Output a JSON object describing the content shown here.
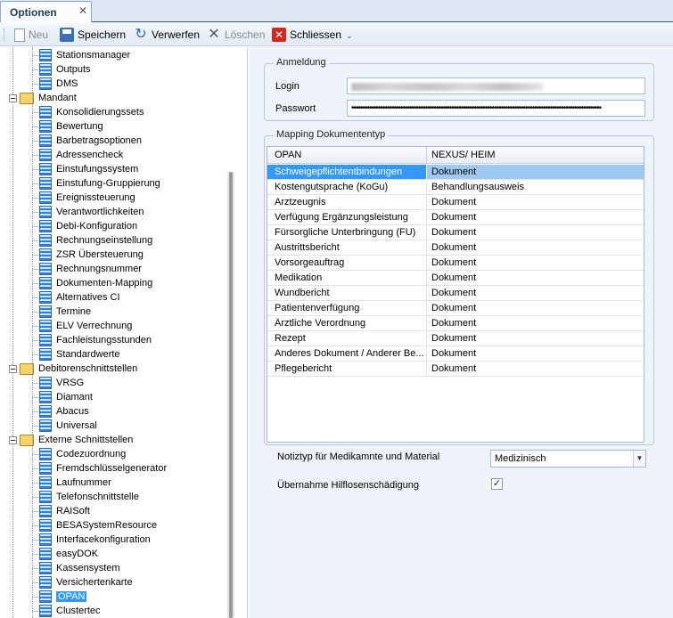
{
  "tab": {
    "label": "Optionen",
    "close": "✕"
  },
  "toolbar": {
    "new": "Neu",
    "save": "Speichern",
    "discard": "Verwerfen",
    "delete": "Löschen",
    "close": "Schliessen"
  },
  "tree": {
    "groups": [
      {
        "label": "Stationsmanager",
        "kind": "leaf"
      },
      {
        "label": "Outputs",
        "kind": "leaf"
      },
      {
        "label": "DMS",
        "kind": "leaf"
      },
      {
        "label": "Mandant",
        "kind": "folder"
      },
      {
        "label": "Konsolidierungssets",
        "kind": "leaf"
      },
      {
        "label": "Bewertung",
        "kind": "leaf"
      },
      {
        "label": "Barbetragsoptionen",
        "kind": "leaf"
      },
      {
        "label": "Adressencheck",
        "kind": "leaf"
      },
      {
        "label": "Einstufungssystem",
        "kind": "leaf"
      },
      {
        "label": "Einstufung-Gruppierung",
        "kind": "leaf"
      },
      {
        "label": "Ereignissteuerung",
        "kind": "leaf"
      },
      {
        "label": "Verantwortlichkeiten",
        "kind": "leaf"
      },
      {
        "label": "Debi-Konfiguration",
        "kind": "leaf"
      },
      {
        "label": "Rechnungseinstellung",
        "kind": "leaf"
      },
      {
        "label": "ZSR Übersteuerung",
        "kind": "leaf"
      },
      {
        "label": "Rechnungsnummer",
        "kind": "leaf"
      },
      {
        "label": "Dokumenten-Mapping",
        "kind": "leaf"
      },
      {
        "label": "Alternatives CI",
        "kind": "leaf"
      },
      {
        "label": "Termine",
        "kind": "leaf"
      },
      {
        "label": "ELV Verrechnung",
        "kind": "leaf"
      },
      {
        "label": "Fachleistungsstunden",
        "kind": "leaf"
      },
      {
        "label": "Standardwerte",
        "kind": "leaf"
      },
      {
        "label": "Debitorenschnittstellen",
        "kind": "folder"
      },
      {
        "label": "VRSG",
        "kind": "leaf"
      },
      {
        "label": "Diamant",
        "kind": "leaf"
      },
      {
        "label": "Abacus",
        "kind": "leaf"
      },
      {
        "label": "Universal",
        "kind": "leaf"
      },
      {
        "label": "Externe Schnittstellen",
        "kind": "folder"
      },
      {
        "label": "Codezuordnung",
        "kind": "leaf"
      },
      {
        "label": "Fremdschlüsselgenerator",
        "kind": "leaf"
      },
      {
        "label": "Laufnummer",
        "kind": "leaf"
      },
      {
        "label": "Telefonschnittstelle",
        "kind": "leaf"
      },
      {
        "label": "RAISoft",
        "kind": "leaf"
      },
      {
        "label": "BESASystemResource",
        "kind": "leaf"
      },
      {
        "label": "Interfacekonfiguration",
        "kind": "leaf"
      },
      {
        "label": "easyDOK",
        "kind": "leaf"
      },
      {
        "label": "Kassensystem",
        "kind": "leaf"
      },
      {
        "label": "Versichertenkarte",
        "kind": "leaf"
      },
      {
        "label": "OPAN",
        "kind": "leaf",
        "selected": true
      },
      {
        "label": "Clustertec",
        "kind": "leaf"
      }
    ]
  },
  "anmeldung": {
    "title": "Anmeldung",
    "login_label": "Login",
    "password_label": "Passwort",
    "password_mask": "••••••••••••••••••••••••••••••••••••••••••••••••••••••••••••••••••••••••••••••••••••••••••••••••••••••••••••••••"
  },
  "mapping": {
    "title": "Mapping Dokumententyp",
    "columns": [
      "OPAN",
      "NEXUS/ HEIM"
    ],
    "rows": [
      {
        "opan": "Schweigepflichtentbindungen",
        "nexus": "Dokument"
      },
      {
        "opan": "Kostengutsprache (KoGu)",
        "nexus": "Behandlungsausweis"
      },
      {
        "opan": "Arztzeugnis",
        "nexus": "Dokument"
      },
      {
        "opan": "Verfügung Ergänzungsleistung",
        "nexus": "Dokument"
      },
      {
        "opan": "Fürsorgliche Unterbringung (FU)",
        "nexus": "Dokument"
      },
      {
        "opan": "Austrittsbericht",
        "nexus": "Dokument"
      },
      {
        "opan": "Vorsorgeauftrag",
        "nexus": "Dokument"
      },
      {
        "opan": "Medikation",
        "nexus": "Dokument"
      },
      {
        "opan": "Wundbericht",
        "nexus": "Dokument"
      },
      {
        "opan": "Patientenverfügung",
        "nexus": "Dokument"
      },
      {
        "opan": "Ärztliche Verordnung",
        "nexus": "Dokument"
      },
      {
        "opan": "Rezept",
        "nexus": "Dokument"
      },
      {
        "opan": "Anderes Dokument / Anderer Be...",
        "nexus": "Dokument"
      },
      {
        "opan": "Pflegebericht",
        "nexus": "Dokument"
      }
    ]
  },
  "notiztyp": {
    "label": "Notiztyp für Medikamnte und Material",
    "value": "Medizinisch"
  },
  "hilflosen": {
    "label": "Übernahme Hilflosenschädigung",
    "checked": true,
    "mark": "✓"
  }
}
